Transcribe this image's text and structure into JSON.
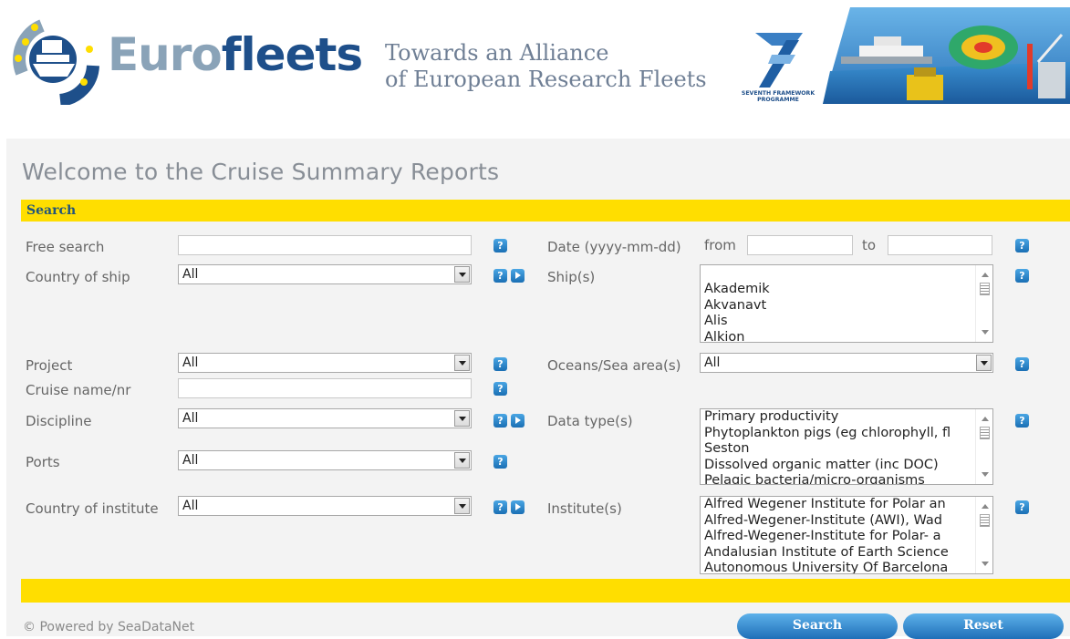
{
  "header": {
    "logo_part1": "Euro",
    "logo_part2": "fleets",
    "tagline_line1": "Towards an Alliance",
    "tagline_line2": "of European Research Fleets",
    "fp7_label_line1": "SEVENTH FRAMEWORK",
    "fp7_label_line2": "PROGRAMME"
  },
  "page_title": "Welcome to the Cruise Summary Reports",
  "search_section_label": "Search",
  "form": {
    "free_search_label": "Free search",
    "free_search_value": "",
    "country_of_ship_label": "Country of ship",
    "country_of_ship_value": "All",
    "project_label": "Project",
    "project_value": "All",
    "cruise_name_label": "Cruise name/nr",
    "cruise_name_value": "",
    "discipline_label": "Discipline",
    "discipline_value": "All",
    "ports_label": "Ports",
    "ports_value": "All",
    "country_of_institute_label": "Country of institute",
    "country_of_institute_value": "All",
    "date_label": "Date (yyyy-mm-dd)",
    "date_from_label": "from",
    "date_from_value": "",
    "date_to_label": "to",
    "date_to_value": "",
    "ships_label": "Ship(s)",
    "ships_options": [
      "Akademik",
      "Akvanavt",
      "Alis",
      "Alkion"
    ],
    "oceans_label": "Oceans/Sea area(s)",
    "oceans_value": "All",
    "data_type_label": "Data type(s)",
    "data_type_options": [
      "Primary productivity",
      "Phytoplankton pigs (eg chlorophyll, fl",
      "Seston",
      "Dissolved organic matter (inc DOC)",
      "Pelagic bacteria/micro-organisms"
    ],
    "institutes_label": "Institute(s)",
    "institutes_options": [
      "Alfred Wegener Institute for Polar an",
      "Alfred-Wegener-Institute (AWI), Wad",
      "Alfred-Wegener-Institute for Polar- a",
      "Andalusian Institute of Earth Science",
      "Autonomous University Of Barcelona"
    ],
    "help_glyph": "?"
  },
  "buttons": {
    "search": "Search",
    "reset": "Reset"
  },
  "footer": "© Powered by SeaDataNet",
  "colors": {
    "accent_yellow": "#ffde00",
    "brand_blue": "#1e4f8a",
    "button_blue": "#1f6fb8"
  },
  "icons": [
    "ship-logo-icon",
    "help-icon",
    "expand-arrow-icon",
    "dropdown-arrow-icon"
  ]
}
